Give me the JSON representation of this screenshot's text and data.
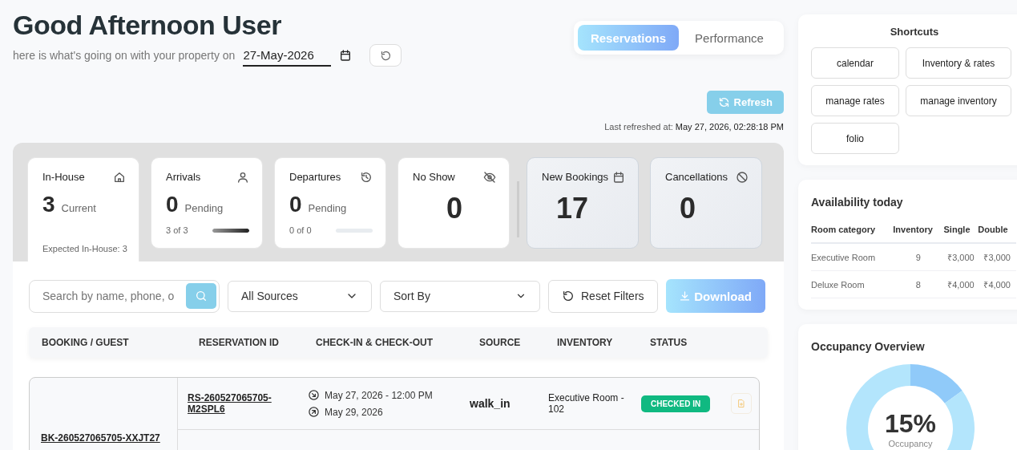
{
  "header": {
    "greeting": "Good Afternoon User",
    "subtitle": "here is what's going on with your property on",
    "date": "27-May-2026"
  },
  "view_tabs": [
    {
      "label": "Reservations",
      "selected": true
    },
    {
      "label": "Performance",
      "selected": false
    }
  ],
  "refresh_button": "Refresh",
  "last_refreshed": {
    "label": "Last refreshed at:",
    "value": "May 27, 2026, 02:28:18 PM"
  },
  "stats": [
    {
      "kind": "expected",
      "title": "In-House",
      "value": "3",
      "unit": "Current",
      "footer": "Expected In-House: 3",
      "selected": true
    },
    {
      "kind": "progress",
      "title": "Arrivals",
      "value": "0",
      "unit": "Pending",
      "count": "3 of 3",
      "level": 1,
      "selected": false
    },
    {
      "kind": "progress",
      "title": "Departures",
      "value": "0",
      "unit": "Pending",
      "count": "0 of 0",
      "level": 0,
      "selected": false
    },
    {
      "kind": "big",
      "title": "No Show",
      "value": "0",
      "selected": false
    },
    {
      "kind": "summary",
      "title": "New Bookings",
      "value": "17",
      "selected": false
    },
    {
      "kind": "summary",
      "title": "Cancellations",
      "value": "0",
      "selected": false
    }
  ],
  "filters": {
    "search": {
      "placeholder": "Search by name, phone, o"
    },
    "source": "All Sources",
    "sort": "Sort By",
    "reset": "Reset Filters",
    "download": "Download"
  },
  "table": {
    "columns": [
      "BOOKING / GUEST",
      "RESERVATION ID",
      "CHECK-IN & CHECK-OUT",
      "SOURCE",
      "INVENTORY",
      "STATUS"
    ],
    "rows": [
      {
        "booking": "BK-260527065705-XXJT27",
        "reservations": [
          {
            "id": "RS-260527065705-M2SPL6",
            "check_in": "May 27, 2026 - 12:00 PM",
            "check_out": "May 29, 2026",
            "source": "walk_in",
            "inventory": "Executive Room - 102",
            "status": "CHECKED IN"
          }
        ]
      }
    ]
  },
  "shortcuts": {
    "title": "Shortcuts",
    "items": [
      "calendar",
      "Inventory & rates",
      "manage rates",
      "manage inventory",
      "folio"
    ]
  },
  "availability": {
    "title": "Availability today",
    "columns": [
      "Room category",
      "Inventory",
      "Single",
      "Double"
    ],
    "rows": [
      [
        "Executive Room",
        "9",
        "₹3,000",
        "₹3,000"
      ],
      [
        "Deluxe Room",
        "8",
        "₹4,000",
        "₹4,000"
      ]
    ]
  },
  "occupancy": {
    "title": "Occupancy Overview",
    "value": "15%",
    "label": "Occupancy",
    "chart_data": {
      "type": "donut",
      "values": [
        15,
        85
      ]
    }
  }
}
